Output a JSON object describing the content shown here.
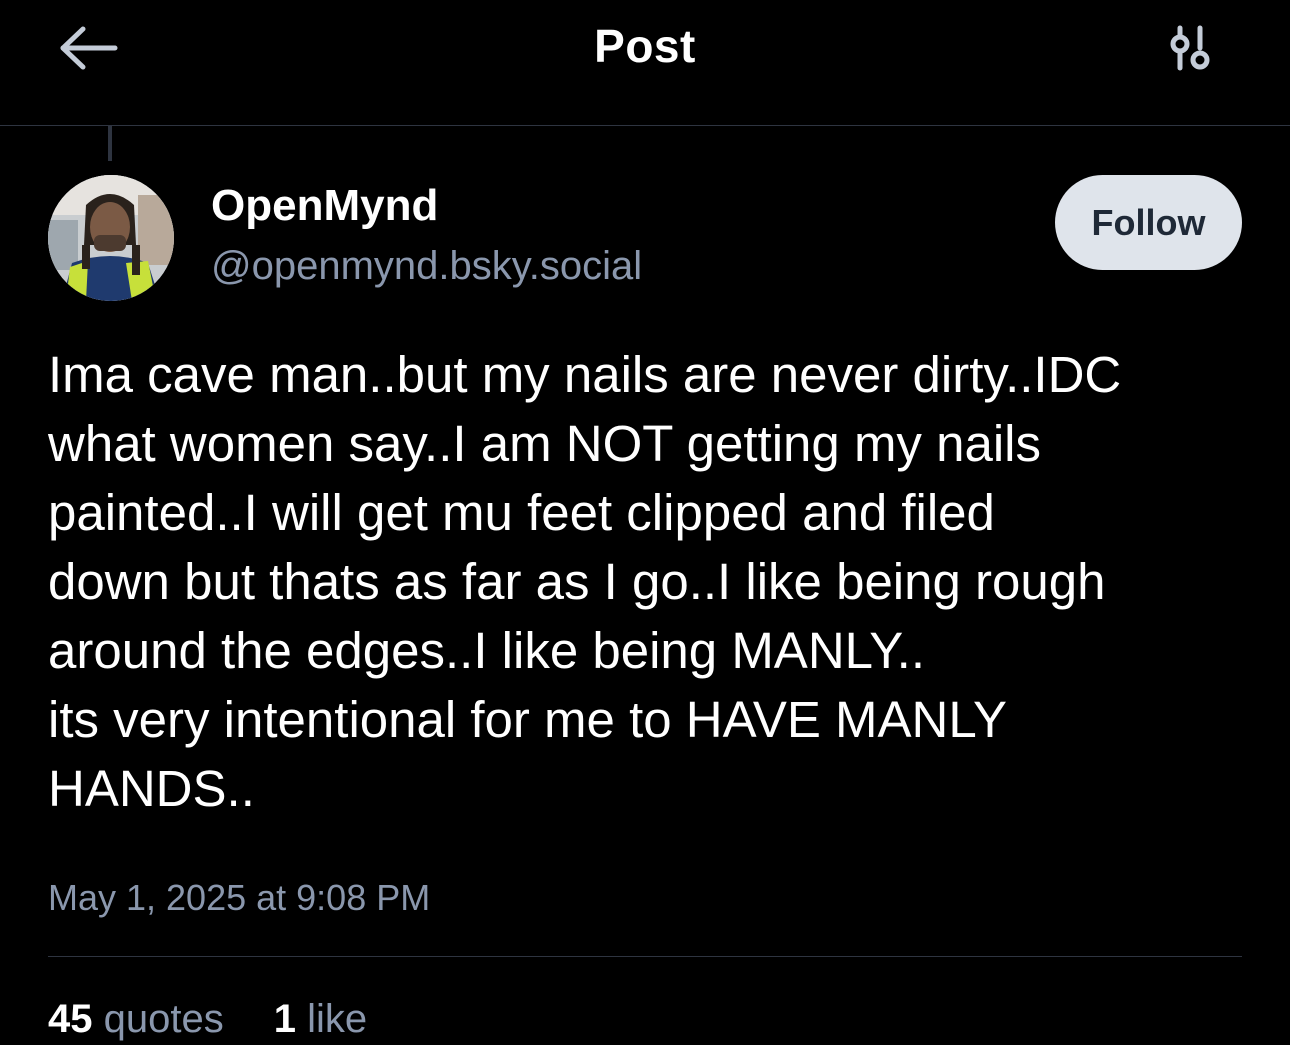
{
  "header": {
    "title": "Post",
    "back_icon": "arrow-left-icon",
    "settings_icon": "sliders-icon"
  },
  "author": {
    "display_name": "OpenMynd",
    "handle": "@openmynd.bsky.social",
    "follow_label": "Follow"
  },
  "post": {
    "lines": [
      "Ima cave man..but my nails are never dirty..IDC",
      "what women say..I am NOT getting my nails",
      "painted..I will get mu feet clipped and filed",
      "down but thats as far as I go..I like being rough",
      "around the edges..I like being MANLY..",
      "its very intentional for me to HAVE MANLY",
      "HANDS.."
    ],
    "timestamp": "May 1, 2025 at 9:08 PM"
  },
  "stats": {
    "quotes_count": "45",
    "quotes_label": "quotes",
    "likes_count": "1",
    "likes_label": "like"
  },
  "colors": {
    "background": "#000000",
    "muted_text": "#8a97ad",
    "divider": "#2e3440",
    "follow_bg": "#dfe4eb"
  }
}
